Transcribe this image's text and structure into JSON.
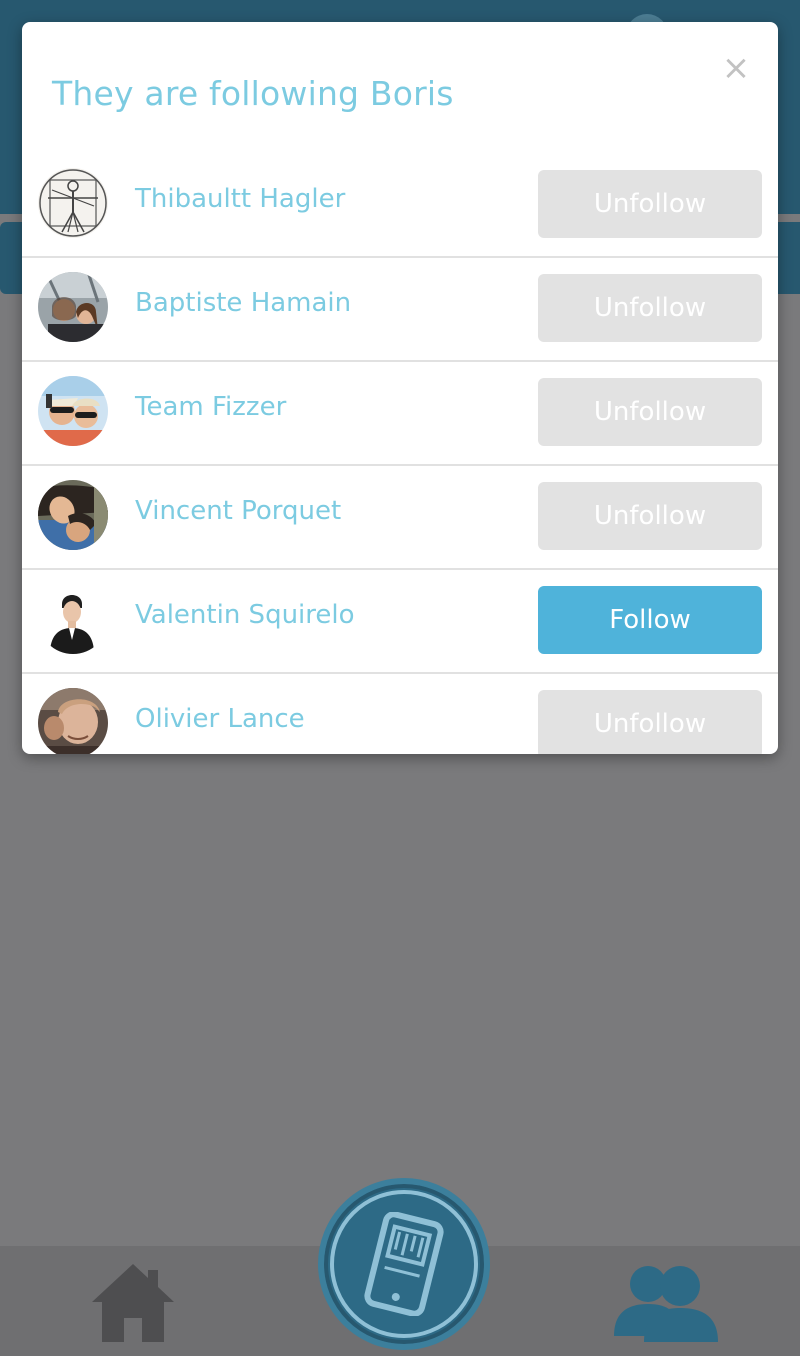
{
  "modal": {
    "title": "They are following Boris",
    "close_glyph": "×"
  },
  "followers": [
    {
      "name": "Thibaultt Hagler",
      "button": "Unfollow",
      "state": "following"
    },
    {
      "name": "Baptiste Hamain",
      "button": "Unfollow",
      "state": "following"
    },
    {
      "name": "Team Fizzer",
      "button": "Unfollow",
      "state": "following"
    },
    {
      "name": "Vincent Porquet",
      "button": "Unfollow",
      "state": "following"
    },
    {
      "name": "Valentin Squirelo",
      "button": "Follow",
      "state": "not-following"
    },
    {
      "name": "Olivier Lance",
      "button": "Unfollow",
      "state": "following"
    }
  ],
  "bottom_nav": {
    "items": [
      {
        "icon": "home-icon"
      },
      {
        "icon": "phone-bill-icon"
      },
      {
        "icon": "friends-icon"
      }
    ]
  },
  "colors": {
    "accent": "#7ccbe1",
    "follow_button": "#4fb3da",
    "unfollow_button": "#e2e2e2",
    "header": "#27586f",
    "overlay": "#7a7a7c"
  }
}
